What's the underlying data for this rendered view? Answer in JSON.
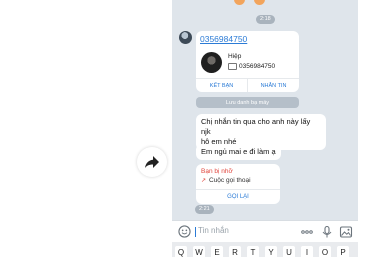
{
  "chat": {
    "time_top": "2:18",
    "time_bottom": "2:21",
    "contact_card": {
      "phone_link": "0356984750",
      "name": "Hiệp",
      "number": "0356984750",
      "add_friend_label": "KẾT BẠN",
      "message_label": "NHẮN TIN"
    },
    "save_label": "Lưu danh bạ máy",
    "messages": [
      "Chị nhắn tin qua cho anh này lấy njk",
      "hộ em nhé",
      "Em ngủ mai e đi làm ạ"
    ],
    "call_card": {
      "missed_label": "Bạn bị nhỡ",
      "call_label": "Cuộc gọi thoại",
      "callback_label": "GỌI LẠI"
    }
  },
  "composer": {
    "placeholder": "Tin nhắn",
    "icons": [
      "sticker-icon",
      "more-icon",
      "microphone-icon",
      "image-icon"
    ]
  },
  "keyboard": {
    "keys": [
      "Q",
      "W",
      "E",
      "R",
      "T",
      "Y",
      "U",
      "I",
      "O",
      "P"
    ]
  },
  "colors": {
    "chat_background": "#dfe5eb",
    "link_blue": "#2b7bd6",
    "missed_red": "#e0443b",
    "chip_gray": "#b5bfc9"
  }
}
